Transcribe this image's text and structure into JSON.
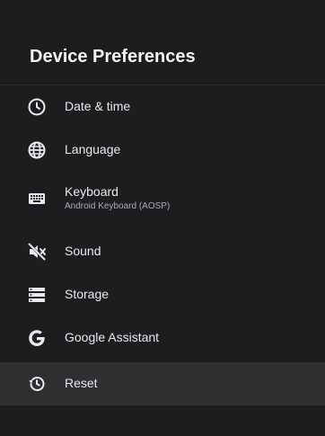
{
  "header": {
    "title": "Device Preferences"
  },
  "items": [
    {
      "label": "Date & time",
      "icon": "clock-icon"
    },
    {
      "label": "Language",
      "icon": "globe-icon"
    },
    {
      "label": "Keyboard",
      "sublabel": "Android Keyboard (AOSP)",
      "icon": "keyboard-icon"
    },
    {
      "label": "Sound",
      "icon": "sound-off-icon"
    },
    {
      "label": "Storage",
      "icon": "storage-icon"
    },
    {
      "label": "Google Assistant",
      "icon": "google-g-icon"
    },
    {
      "label": "Reset",
      "icon": "reset-history-icon",
      "selected": true
    }
  ],
  "colors": {
    "background": "#1c1d1f",
    "selected_row": "#2e2f31",
    "text": "#e8eaed",
    "secondary_text": "#a8abaf"
  }
}
